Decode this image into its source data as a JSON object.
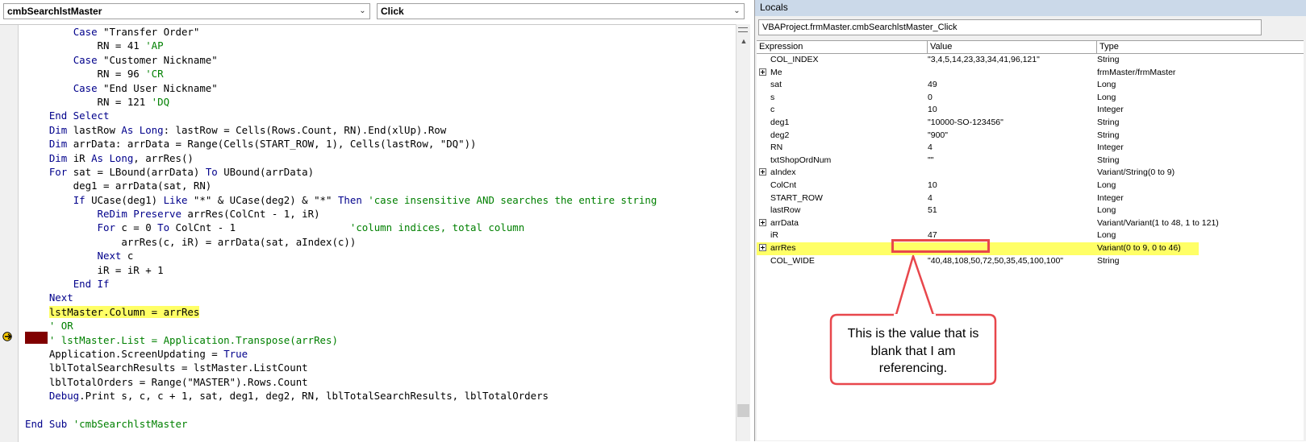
{
  "editor": {
    "object_combo": "cmbSearchlstMaster",
    "procedure_combo": "Click",
    "code_lines": [
      [
        {
          "t": "        "
        },
        {
          "t": "Case",
          "c": "kw"
        },
        {
          "t": " \"Transfer Order\""
        }
      ],
      [
        {
          "t": "            RN = 41 "
        },
        {
          "t": "'AP",
          "c": "cm"
        }
      ],
      [
        {
          "t": "        "
        },
        {
          "t": "Case",
          "c": "kw"
        },
        {
          "t": " \"Customer Nickname\""
        }
      ],
      [
        {
          "t": "            RN = 96 "
        },
        {
          "t": "'CR",
          "c": "cm"
        }
      ],
      [
        {
          "t": "        "
        },
        {
          "t": "Case",
          "c": "kw"
        },
        {
          "t": " \"End User Nickname\""
        }
      ],
      [
        {
          "t": "            RN = 121 "
        },
        {
          "t": "'DQ",
          "c": "cm"
        }
      ],
      [
        {
          "t": "    "
        },
        {
          "t": "End Select",
          "c": "kw"
        }
      ],
      [
        {
          "t": "    "
        },
        {
          "t": "Dim",
          "c": "kw"
        },
        {
          "t": " lastRow "
        },
        {
          "t": "As Long",
          "c": "kw"
        },
        {
          "t": ": lastRow = Cells(Rows.Count, RN).End(xlUp).Row"
        }
      ],
      [
        {
          "t": "    "
        },
        {
          "t": "Dim",
          "c": "kw"
        },
        {
          "t": " arrData: arrData = Range(Cells(START_ROW, 1), Cells(lastRow, \"DQ\"))"
        }
      ],
      [
        {
          "t": "    "
        },
        {
          "t": "Dim",
          "c": "kw"
        },
        {
          "t": " iR "
        },
        {
          "t": "As Long",
          "c": "kw"
        },
        {
          "t": ", arrRes()"
        }
      ],
      [
        {
          "t": "    "
        },
        {
          "t": "For",
          "c": "kw"
        },
        {
          "t": " sat = LBound(arrData) "
        },
        {
          "t": "To",
          "c": "kw"
        },
        {
          "t": " UBound(arrData)"
        }
      ],
      [
        {
          "t": "        deg1 = arrData(sat, RN)"
        }
      ],
      [
        {
          "t": "        "
        },
        {
          "t": "If",
          "c": "kw"
        },
        {
          "t": " UCase(deg1) "
        },
        {
          "t": "Like",
          "c": "kw"
        },
        {
          "t": " \"*\" & UCase(deg2) & \"*\" "
        },
        {
          "t": "Then",
          "c": "kw"
        },
        {
          "t": " "
        },
        {
          "t": "'case insensitive AND searches the entire string",
          "c": "cm"
        }
      ],
      [
        {
          "t": "            "
        },
        {
          "t": "ReDim Preserve",
          "c": "kw"
        },
        {
          "t": " arrRes(ColCnt - 1, iR)"
        }
      ],
      [
        {
          "t": "            "
        },
        {
          "t": "For",
          "c": "kw"
        },
        {
          "t": " c = 0 "
        },
        {
          "t": "To",
          "c": "kw"
        },
        {
          "t": " ColCnt - 1                   "
        },
        {
          "t": "'column indices, total column",
          "c": "cm"
        }
      ],
      [
        {
          "t": "                arrRes(c, iR) = arrData(sat, aIndex(c))"
        }
      ],
      [
        {
          "t": "            "
        },
        {
          "t": "Next",
          "c": "kw"
        },
        {
          "t": " c"
        }
      ],
      [
        {
          "t": "            iR = iR + 1"
        }
      ],
      [
        {
          "t": "        "
        },
        {
          "t": "End If",
          "c": "kw"
        }
      ],
      [
        {
          "t": "    "
        },
        {
          "t": "Next",
          "c": "kw"
        }
      ],
      [
        {
          "t": "    "
        },
        {
          "t": "lstMaster.Column = arrRes",
          "c": "hl"
        }
      ],
      [
        {
          "t": "    "
        },
        {
          "t": "' OR",
          "c": "cm"
        }
      ],
      [
        {
          "t": "    "
        },
        {
          "t": "' lstMaster.List = Application.Transpose(arrRes)",
          "c": "cm"
        }
      ],
      [
        {
          "t": "    Application.ScreenUpdating = "
        },
        {
          "t": "True",
          "c": "kw"
        }
      ],
      [
        {
          "t": "    lblTotalSearchResults = lstMaster.ListCount"
        }
      ],
      [
        {
          "t": "    lblTotalOrders = Range(\"MASTER\").Rows.Count"
        }
      ],
      [
        {
          "t": "    "
        },
        {
          "t": "Debug",
          "c": "kw"
        },
        {
          "t": ".Print s, c, c + 1, sat, deg1, deg2, RN, lblTotalSearchResults, lblTotalOrders"
        }
      ],
      [
        {
          "t": ""
        }
      ],
      [
        {
          "t": "End Sub",
          "c": "kw"
        },
        {
          "t": " "
        },
        {
          "t": "'cmbSearchlstMaster",
          "c": "cm"
        }
      ]
    ]
  },
  "locals": {
    "title": "Locals",
    "context": "VBAProject.frmMaster.cmbSearchlstMaster_Click",
    "headers": {
      "expression": "Expression",
      "value": "Value",
      "type": "Type"
    },
    "rows": [
      {
        "expr": "COL_INDEX",
        "value": "\"3,4,5,14,23,33,34,41,96,121\"",
        "type": "String",
        "expandable": false
      },
      {
        "expr": "Me",
        "value": "",
        "type": "frmMaster/frmMaster",
        "expandable": true
      },
      {
        "expr": "sat",
        "value": "49",
        "type": "Long",
        "expandable": false
      },
      {
        "expr": "s",
        "value": "0",
        "type": "Long",
        "expandable": false
      },
      {
        "expr": "c",
        "value": "10",
        "type": "Integer",
        "expandable": false
      },
      {
        "expr": "deg1",
        "value": "\"10000-SO-123456\"",
        "type": "String",
        "expandable": false
      },
      {
        "expr": "deg2",
        "value": "\"900\"",
        "type": "String",
        "expandable": false
      },
      {
        "expr": "RN",
        "value": "4",
        "type": "Integer",
        "expandable": false
      },
      {
        "expr": "txtShopOrdNum",
        "value": "\"\"",
        "type": "String",
        "expandable": false
      },
      {
        "expr": "aIndex",
        "value": "",
        "type": "Variant/String(0 to 9)",
        "expandable": true
      },
      {
        "expr": "ColCnt",
        "value": "10",
        "type": "Long",
        "expandable": false
      },
      {
        "expr": "START_ROW",
        "value": "4",
        "type": "Integer",
        "expandable": false
      },
      {
        "expr": "lastRow",
        "value": "51",
        "type": "Long",
        "expandable": false
      },
      {
        "expr": "arrData",
        "value": "",
        "type": "Variant/Variant(1 to 48, 1 to 121)",
        "expandable": true
      },
      {
        "expr": "iR",
        "value": "47",
        "type": "Long",
        "expandable": false
      },
      {
        "expr": "arrRes",
        "value": "",
        "type": "Variant(0 to 9, 0 to 46)",
        "expandable": true,
        "highlighted": true
      },
      {
        "expr": "COL_WIDE",
        "value": "\"40,48,108,50,72,50,35,45,100,100\"",
        "type": "String",
        "expandable": false
      }
    ]
  },
  "annotation": {
    "callout_text": "This is the value that is blank that I am referencing.",
    "accent_color": "#e8474c"
  },
  "colors": {
    "keyword": "#00008b",
    "comment": "#008000",
    "highlight": "#ffff66",
    "breakpoint": "#800000",
    "title_bar": "#cbd9e9"
  }
}
